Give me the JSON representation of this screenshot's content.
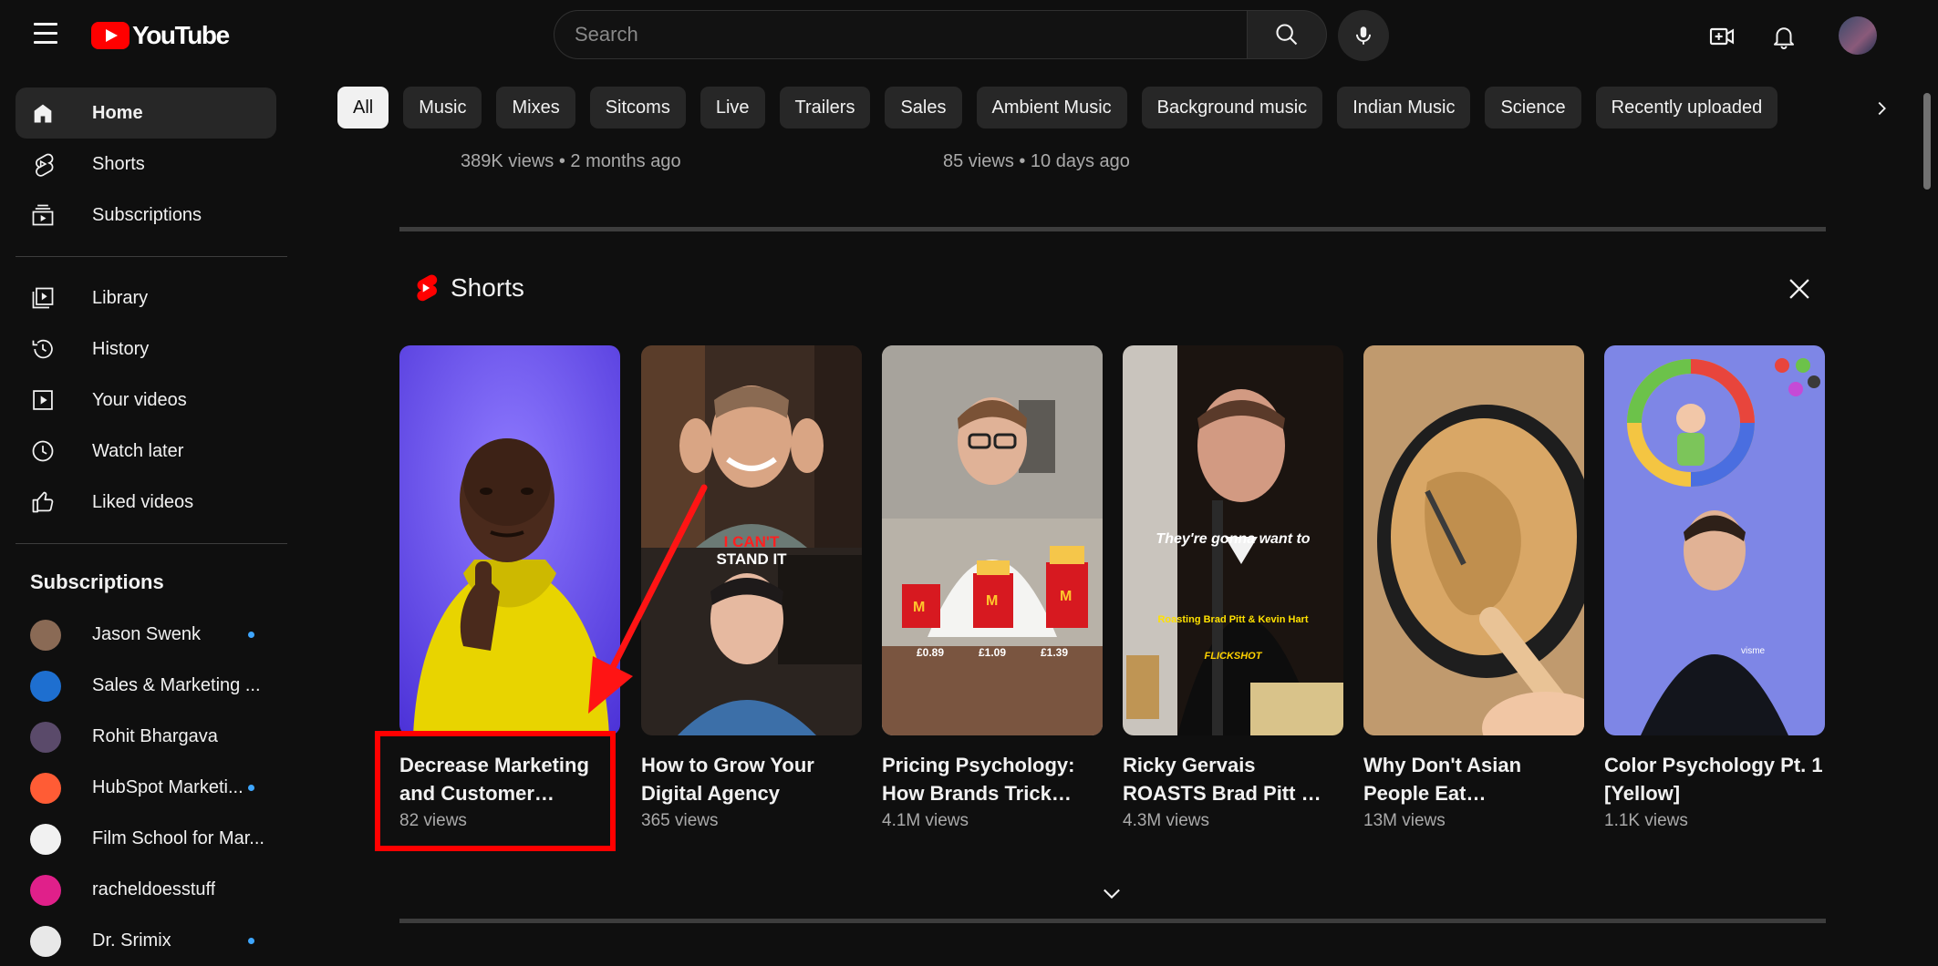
{
  "header": {
    "logo_text": "YouTube",
    "search_placeholder": "Search"
  },
  "sidebar": {
    "main_items": [
      {
        "label": "Home",
        "icon": "home-icon",
        "active": true
      },
      {
        "label": "Shorts",
        "icon": "shorts-icon"
      },
      {
        "label": "Subscriptions",
        "icon": "subscriptions-icon"
      }
    ],
    "library_items": [
      {
        "label": "Library",
        "icon": "library-icon"
      },
      {
        "label": "History",
        "icon": "history-icon"
      },
      {
        "label": "Your videos",
        "icon": "your-videos-icon"
      },
      {
        "label": "Watch later",
        "icon": "watch-later-icon"
      },
      {
        "label": "Liked videos",
        "icon": "liked-videos-icon"
      }
    ],
    "subscriptions_heading": "Subscriptions",
    "subscriptions": [
      {
        "label": "Jason Swenk",
        "new": true,
        "color": "#8a6a55"
      },
      {
        "label": "Sales & Marketing ...",
        "new": false,
        "color": "#1e6fd0"
      },
      {
        "label": "Rohit Bhargava",
        "new": false,
        "color": "#5a4a6a"
      },
      {
        "label": "HubSpot Marketi...",
        "new": true,
        "color": "#ff5c35"
      },
      {
        "label": "Film School for Mar...",
        "new": false,
        "color": "#f1f1f1"
      },
      {
        "label": "racheldoesstuff",
        "new": false,
        "color": "#e0208a"
      },
      {
        "label": "Dr. Srimix",
        "new": true,
        "color": "#e8e8e8"
      }
    ]
  },
  "chips": [
    "All",
    "Music",
    "Mixes",
    "Sitcoms",
    "Live",
    "Trailers",
    "Sales",
    "Ambient Music",
    "Background music",
    "Indian Music",
    "Science",
    "Recently uploaded"
  ],
  "feed_top": {
    "video1_meta": "389K views • 2 months ago",
    "video2_meta": "85 views • 10 days ago"
  },
  "shorts": {
    "heading": "Shorts",
    "items": [
      {
        "title": "Decrease Marketing and Customer…",
        "views": "82 views"
      },
      {
        "title": "How to Grow Your Digital Agency",
        "views": "365 views",
        "overlay": [
          "I CAN'T",
          "STAND IT"
        ]
      },
      {
        "title": "Pricing Psychology: How Brands Trick…",
        "views": "4.1M views",
        "prices": [
          "£0.89",
          "£1.09",
          "£1.39"
        ]
      },
      {
        "title": "Ricky Gervais ROASTS Brad Pitt …",
        "views": "4.3M views",
        "caption": "They're gonna want to",
        "subcaption": "Roasting Brad Pitt & Kevin Hart",
        "brand": "FLICKSHOT"
      },
      {
        "title": "Why Don't Asian People Eat…",
        "views": "13M views"
      },
      {
        "title": "Color Psychology Pt. 1 [Yellow]",
        "views": "1.1K views",
        "shirt": "visme"
      }
    ]
  },
  "colors": {
    "background": "#0f0f0f",
    "brand_red": "#ff0000",
    "chip_bg": "#272727",
    "annotation_red": "#ff0000"
  }
}
